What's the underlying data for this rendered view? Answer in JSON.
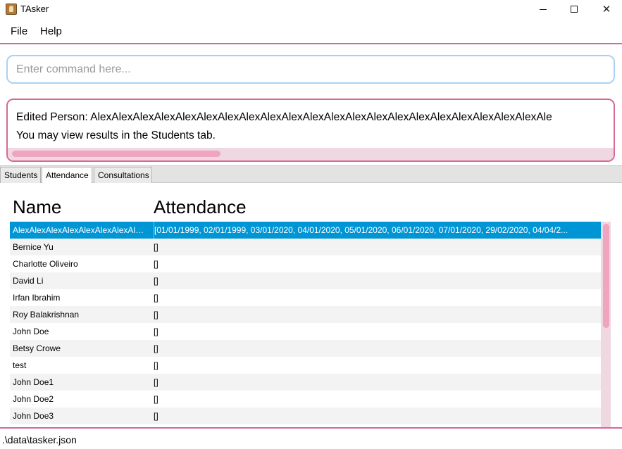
{
  "window": {
    "title": "TAsker",
    "app_icon": "tasker-app-icon",
    "controls": {
      "minimize_icon": "minimize-icon",
      "maximize_icon": "maximize-icon",
      "close_glyph": "✕"
    }
  },
  "menu": {
    "file": "File",
    "help": "Help"
  },
  "command": {
    "placeholder": "Enter command here...",
    "value": ""
  },
  "result": {
    "line1": "Edited Person: AlexAlexAlexAlexAlexAlexAlexAlexAlexAlexAlexAlexAlexAlexAlexAlexAlexAlexAlexAlexAlexAle",
    "line2": "You may view results in the Students tab."
  },
  "tabs": {
    "students": "Students",
    "attendance": "Attendance",
    "consultations": "Consultations",
    "active": "Attendance"
  },
  "table": {
    "headers": {
      "name": "Name",
      "attendance": "Attendance"
    },
    "rows": [
      {
        "name": "AlexAlexAlexAlexAlexAlexAlexAlex...",
        "attendance": "[01/01/1999, 02/01/1999, 03/01/2020, 04/01/2020, 05/01/2020, 06/01/2020, 07/01/2020, 29/02/2020, 04/04/2...",
        "selected": true
      },
      {
        "name": "Bernice Yu",
        "attendance": "[]"
      },
      {
        "name": "Charlotte Oliveiro",
        "attendance": "[]"
      },
      {
        "name": "David Li",
        "attendance": "[]"
      },
      {
        "name": "Irfan Ibrahim",
        "attendance": "[]"
      },
      {
        "name": "Roy Balakrishnan",
        "attendance": "[]"
      },
      {
        "name": "John Doe",
        "attendance": "[]"
      },
      {
        "name": "Betsy Crowe",
        "attendance": "[]"
      },
      {
        "name": "test",
        "attendance": "[]"
      },
      {
        "name": "John Doe1",
        "attendance": "[]"
      },
      {
        "name": "John Doe2",
        "attendance": "[]"
      },
      {
        "name": "John Doe3",
        "attendance": "[]"
      }
    ]
  },
  "status": {
    "path": ".\\data\\tasker.json"
  },
  "colors": {
    "accent_pink": "#d26a9a",
    "selection_blue": "#0096d6",
    "command_border": "#a9d2f2"
  }
}
